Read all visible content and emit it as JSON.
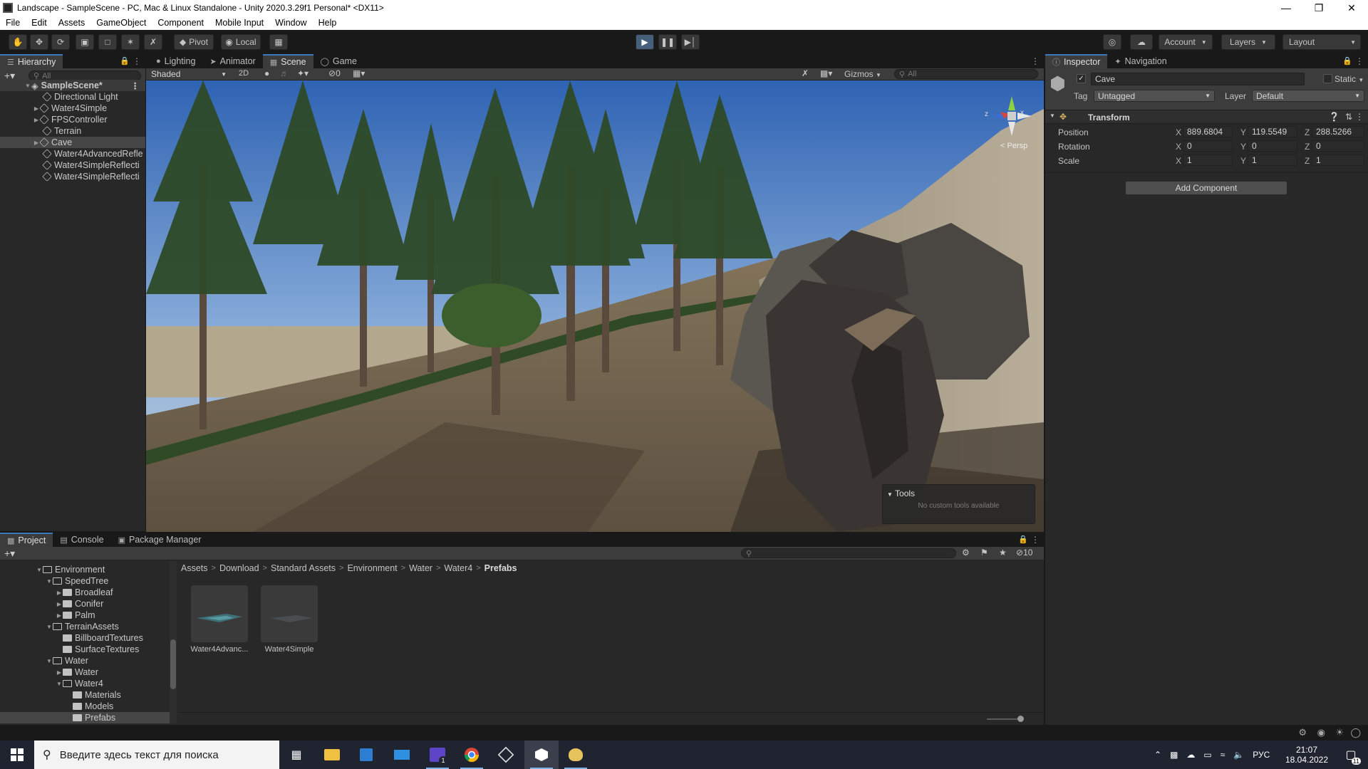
{
  "window": {
    "title": "Landscape - SampleScene - PC, Mac & Linux Standalone - Unity 2020.3.29f1 Personal* <DX11>",
    "controls": [
      "minimize-icon",
      "restore-icon",
      "close-icon"
    ]
  },
  "menu": [
    "File",
    "Edit",
    "Assets",
    "GameObject",
    "Component",
    "Mobile Input",
    "Window",
    "Help"
  ],
  "toolbar": {
    "pivot_label": "Pivot",
    "local_label": "Local",
    "account_label": "Account",
    "layers_label": "Layers",
    "layout_label": "Layout",
    "play_state": "playing"
  },
  "hierarchy": {
    "tab_label": "Hierarchy",
    "search_placeholder": "All",
    "scene_name": "SampleScene*",
    "items": [
      {
        "label": "Directional Light"
      },
      {
        "label": "Water4Simple"
      },
      {
        "label": "FPSController"
      },
      {
        "label": "Terrain"
      },
      {
        "label": "Cave"
      },
      {
        "label": "Water4AdvancedRefle"
      },
      {
        "label": "Water4SimpleReflecti"
      },
      {
        "label": "Water4SimpleReflecti"
      }
    ]
  },
  "scene": {
    "tabs": [
      "Lighting",
      "Animator",
      "Scene",
      "Game"
    ],
    "active_tab": "Scene",
    "shading_mode": "Shaded",
    "mode_2d_label": "2D",
    "hidden_count": "0",
    "gizmos_label": "Gizmos",
    "search_placeholder": "All",
    "projection_label": "< Persp",
    "axis_x": "x",
    "axis_z": "z",
    "tools_title": "Tools",
    "tools_empty": "No custom tools available"
  },
  "inspector": {
    "tabs": [
      "Inspector",
      "Navigation"
    ],
    "object_name": "Cave",
    "static_label": "Static",
    "tag_label": "Tag",
    "tag_value": "Untagged",
    "layer_label": "Layer",
    "layer_value": "Default",
    "transform_title": "Transform",
    "position_label": "Position",
    "rotation_label": "Rotation",
    "scale_label": "Scale",
    "position": {
      "x": "889.6804",
      "y": "119.5549",
      "z": "288.5266"
    },
    "rotation": {
      "x": "0",
      "y": "0",
      "z": "0"
    },
    "scale": {
      "x": "1",
      "y": "1",
      "z": "1"
    },
    "add_component_label": "Add Component"
  },
  "project": {
    "tabs": [
      "Project",
      "Console",
      "Package Manager"
    ],
    "hidden_count": "10",
    "tree": [
      {
        "label": "Environment",
        "indent": 0,
        "expanded": true
      },
      {
        "label": "SpeedTree",
        "indent": 1,
        "expanded": true
      },
      {
        "label": "Broadleaf",
        "indent": 2,
        "expanded": false
      },
      {
        "label": "Conifer",
        "indent": 2,
        "expanded": false
      },
      {
        "label": "Palm",
        "indent": 2,
        "expanded": false
      },
      {
        "label": "TerrainAssets",
        "indent": 1,
        "expanded": true
      },
      {
        "label": "BillboardTextures",
        "indent": 2,
        "expanded": null
      },
      {
        "label": "SurfaceTextures",
        "indent": 2,
        "expanded": null
      },
      {
        "label": "Water",
        "indent": 1,
        "expanded": true
      },
      {
        "label": "Water",
        "indent": 2,
        "expanded": false
      },
      {
        "label": "Water4",
        "indent": 2,
        "expanded": true
      },
      {
        "label": "Materials",
        "indent": 3,
        "expanded": null
      },
      {
        "label": "Models",
        "indent": 3,
        "expanded": null
      },
      {
        "label": "Prefabs",
        "indent": 3,
        "expanded": null
      }
    ],
    "breadcrumb": [
      "Assets",
      "Download",
      "Standard Assets",
      "Environment",
      "Water",
      "Water4",
      "Prefabs"
    ],
    "assets": [
      {
        "label": "Water4Advanc..."
      },
      {
        "label": "Water4Simple"
      }
    ]
  },
  "taskbar": {
    "search_placeholder": "Введите здесь текст для поиска",
    "language": "РУС",
    "time": "21:07",
    "date": "18.04.2022",
    "notification_count": "11",
    "badge_count": "1"
  },
  "colors": {
    "accent": "#3a79bb",
    "play_active": "#46607c",
    "panel_bg": "#282828",
    "dark_bg": "#191919"
  }
}
